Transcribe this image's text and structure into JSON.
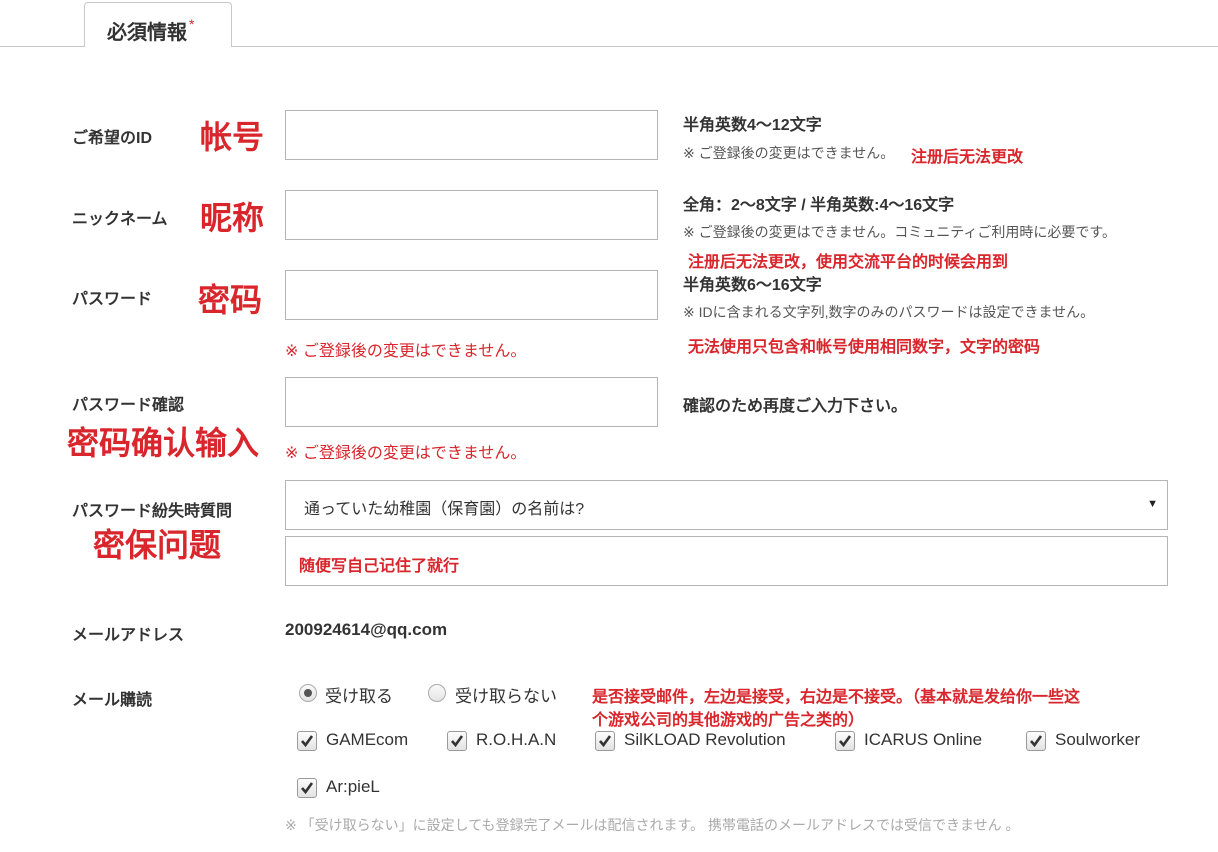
{
  "tab": {
    "label": "必須情報",
    "required_mark": "*"
  },
  "fields": {
    "id": {
      "label": "ご希望のID",
      "annotation": "帐号",
      "value": "",
      "hint_main": "半角英数4～12文字",
      "hint_sub": "※ ご登録後の変更はできません。",
      "note": "注册后无法更改"
    },
    "nickname": {
      "label": "ニックネーム",
      "annotation": "昵称",
      "value": "",
      "hint_main": "全角：2～8文字 / 半角英数:4～16文字",
      "hint_sub": "※ ご登録後の変更はできません。コミュニティご利用時に必要です。",
      "note": "注册后无法更改，使用交流平台的时候会用到"
    },
    "password": {
      "label": "パスワード",
      "annotation": "密码",
      "value": "",
      "hint_main": "半角英数6～16文字",
      "hint_sub": "※ IDに含まれる文字列,数字のみのパスワードは設定できません。",
      "note": "无法使用只包含和帐号使用相同数字，文字的密码",
      "error": "※ ご登録後の変更はできません。"
    },
    "password_confirm": {
      "label": "パスワード確認",
      "annotation": "密码确认输入",
      "value": "",
      "hint_main": "確認のため再度ご入力下さい。",
      "error": "※ ご登録後の変更はできません。"
    },
    "security_question": {
      "label": "パスワード紛失時質問",
      "annotation": "密保问题",
      "selected": "通っていた幼稚園（保育園）の名前は?",
      "arrow": "▼",
      "answer": "随便写自己记住了就行"
    },
    "email": {
      "label": "メールアドレス",
      "value": "200924614@qq.com"
    },
    "mail_subscription": {
      "label": "メール購読",
      "options": [
        {
          "label": "受け取る",
          "selected": true
        },
        {
          "label": "受け取らない",
          "selected": false
        }
      ],
      "note_line1": "是否接受邮件，左边是接受，右边是不接受。（基本就是发给你一些这",
      "note_line2": "个游戏公司的其他游戏的广告之类的）",
      "games": [
        {
          "label": "GAMEcom",
          "checked": true
        },
        {
          "label": "R.O.H.A.N",
          "checked": true
        },
        {
          "label": "SilKLOAD Revolution",
          "checked": true
        },
        {
          "label": "ICARUS Online",
          "checked": true
        },
        {
          "label": "Soulworker",
          "checked": true
        },
        {
          "label": "Ar:pieL",
          "checked": true
        }
      ]
    }
  },
  "footer_note": "※ 「受け取らない」に設定しても登録完了メールは配信されます。 携帯電話のメールアドレスでは受信できません 。",
  "colors": {
    "accent_red": "#d9262c",
    "border": "#b5b5b5",
    "text": "#333333"
  }
}
